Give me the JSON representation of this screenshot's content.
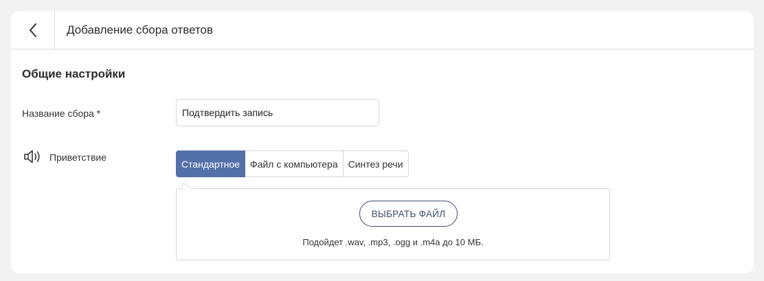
{
  "header": {
    "back_icon": "chevron-left-icon",
    "title": "Добавление сбора ответов"
  },
  "section": {
    "title": "Общие настройки"
  },
  "name_field": {
    "label": "Название сбора *",
    "value": "Подтвердить запись"
  },
  "greeting": {
    "icon": "speaker-icon",
    "label": "Приветствие",
    "tabs": [
      {
        "label": "Стандартное",
        "active": true
      },
      {
        "label": "Файл с компьютера",
        "active": false
      },
      {
        "label": "Синтез речи",
        "active": false
      }
    ],
    "upload": {
      "button_label": "ВЫБРАТЬ ФАЙЛ",
      "hint": "Подойдет .wav, .mp3, .ogg и .m4a до 10 МБ."
    }
  },
  "colors": {
    "accent": "#5470a8",
    "button_border": "#3d4a6b",
    "background": "#f1f2f1"
  }
}
